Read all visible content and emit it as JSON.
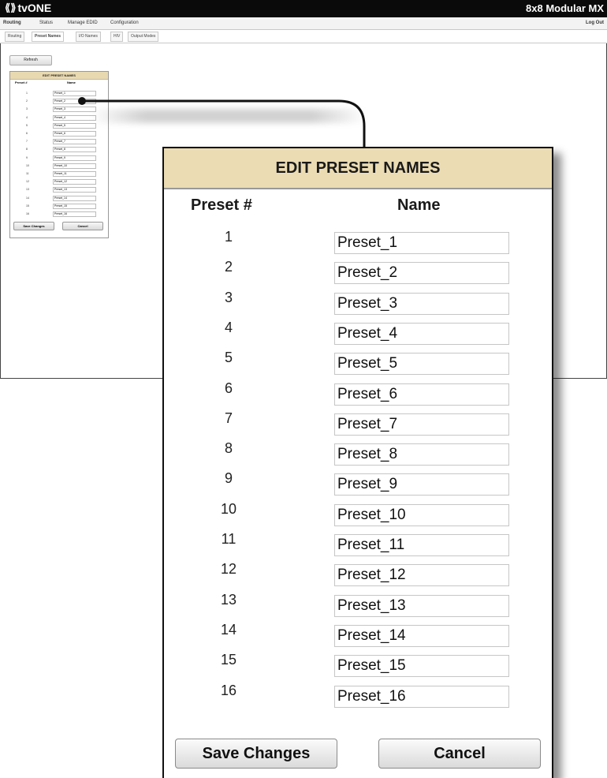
{
  "app": {
    "brand": "tvONE",
    "product": "8x8 Modular MX",
    "menu": [
      "Routing",
      "Status",
      "Manage EDID",
      "Configuration"
    ],
    "logout": "Log Out",
    "subtabs": [
      "Routing",
      "Preset Names",
      "I/O Names",
      "HIV",
      "Output Modes"
    ],
    "refresh_label": "Refresh"
  },
  "panel": {
    "title": "EDIT PRESET NAMES",
    "col_number": "Preset #",
    "col_name": "Name",
    "rows": [
      {
        "num": "1",
        "name": "Preset_1"
      },
      {
        "num": "2",
        "name": "Preset_2"
      },
      {
        "num": "3",
        "name": "Preset_3"
      },
      {
        "num": "4",
        "name": "Preset_4"
      },
      {
        "num": "5",
        "name": "Preset_5"
      },
      {
        "num": "6",
        "name": "Preset_6"
      },
      {
        "num": "7",
        "name": "Preset_7"
      },
      {
        "num": "8",
        "name": "Preset_8"
      },
      {
        "num": "9",
        "name": "Preset_9"
      },
      {
        "num": "10",
        "name": "Preset_10"
      },
      {
        "num": "11",
        "name": "Preset_11"
      },
      {
        "num": "12",
        "name": "Preset_12"
      },
      {
        "num": "13",
        "name": "Preset_13"
      },
      {
        "num": "14",
        "name": "Preset_14"
      },
      {
        "num": "15",
        "name": "Preset_15"
      },
      {
        "num": "16",
        "name": "Preset_16"
      }
    ],
    "save_label": "Save Changes",
    "cancel_label": "Cancel"
  },
  "colors": {
    "header_bg": "#ecdcb3",
    "topbar_bg": "#0a0a0a"
  }
}
